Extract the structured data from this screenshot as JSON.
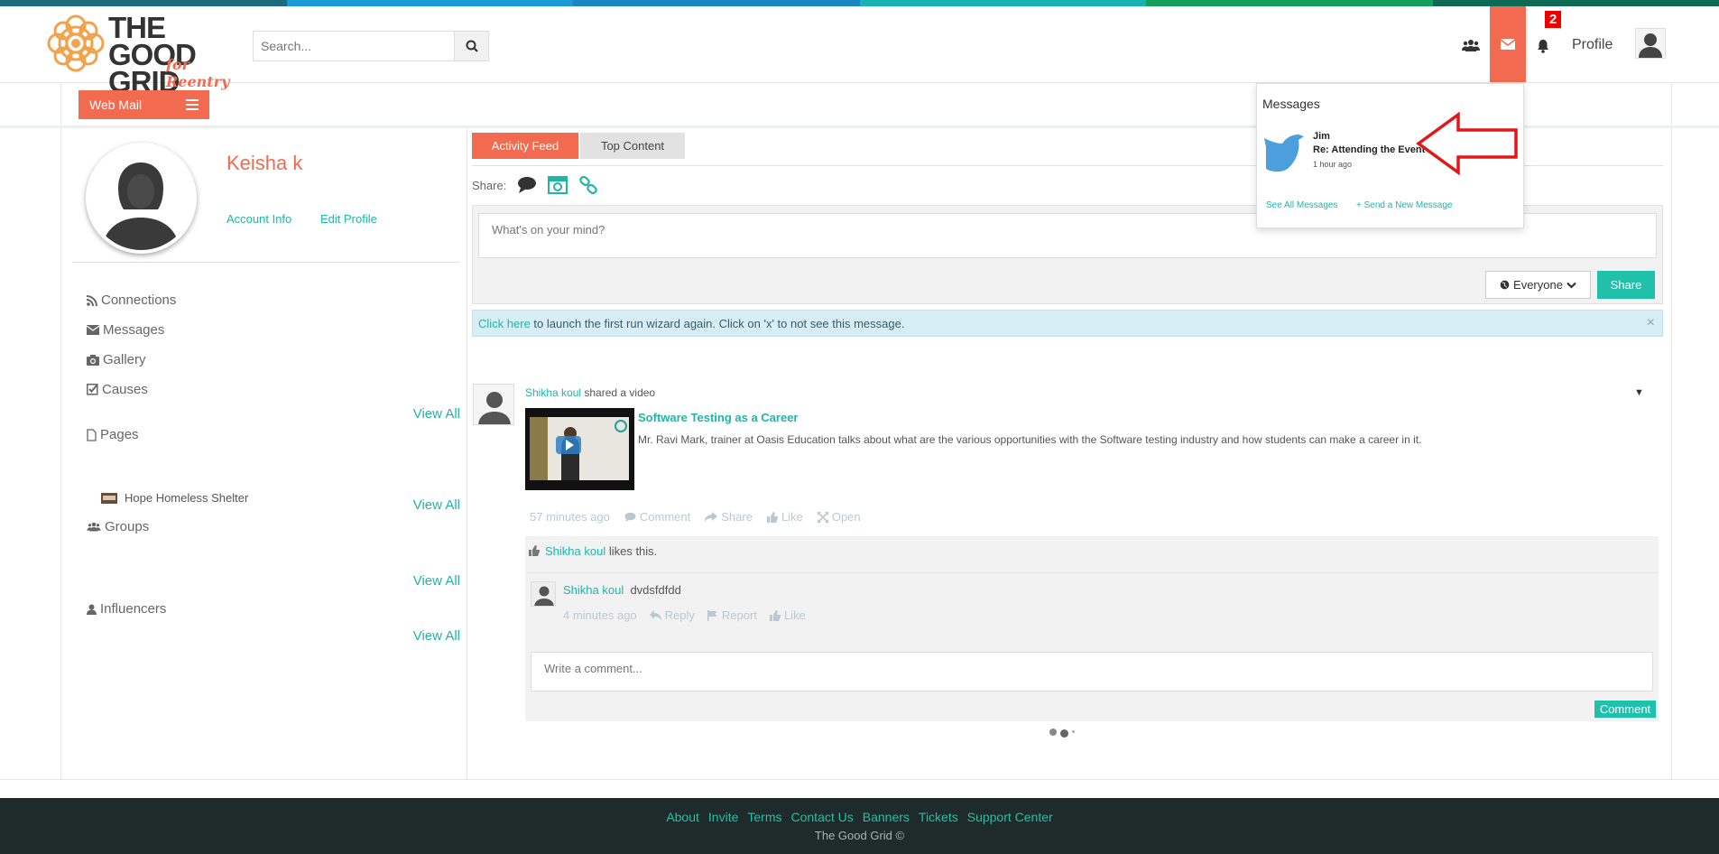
{
  "colors": {
    "accent": "#f26b50",
    "teal": "#20b5a8",
    "button_teal": "#20c0aa",
    "stripe": [
      "#1c6b7a",
      "#1b9bd6",
      "#1a86c6",
      "#19b3b5",
      "#14a05a",
      "#0d6b55"
    ]
  },
  "header": {
    "logo_line1": "THE GOOD",
    "logo_line2": "GRID",
    "logo_tagline": "for Reentry",
    "search_placeholder": "Search...",
    "icons": [
      "users-icon",
      "envelope-icon",
      "bell-icon"
    ],
    "notification_count": "2",
    "profile_label": "Profile"
  },
  "subbar": {
    "webmail_label": "Web Mail"
  },
  "profile": {
    "name": "Keisha k",
    "account_info": "Account Info",
    "edit_profile": "Edit Profile"
  },
  "sidebar": {
    "connections": "Connections",
    "messages": "Messages",
    "gallery": "Gallery",
    "causes": "Causes",
    "pages": "Pages",
    "page_item": "Hope Homeless Shelter",
    "groups": "Groups",
    "influencers": "Influencers",
    "view_all": "View All"
  },
  "main": {
    "tabs": [
      "Activity Feed",
      "Top Content"
    ],
    "share_label": "Share:",
    "composer_placeholder": "What's on your mind?",
    "visibility": "Everyone",
    "share_button": "Share",
    "alert_link": "Click here",
    "alert_text": " to launch the first run wizard again. Click on 'x' to not see this message.",
    "alert_close": "×"
  },
  "post": {
    "author": "Shikha koul",
    "action": " shared a video",
    "video_title": "Software Testing as a Career",
    "video_desc": "Mr. Ravi Mark, trainer at Oasis Education talks about what are the various opportunities with the Software testing industry and how students can make a career in it.",
    "time": "57 minutes ago",
    "comment": "Comment",
    "share": "Share",
    "like": "Like",
    "open": "Open",
    "likes_author": "Shikha koul",
    "likes_text": " likes this.",
    "comment_item": {
      "author": "Shikha koul",
      "text": "dvdsfdfdd",
      "time": "4 minutes ago",
      "reply": "Reply",
      "report": "Report",
      "like": "Like"
    },
    "comment_placeholder": "Write a comment...",
    "comment_button": "Comment"
  },
  "messages_dropdown": {
    "title": "Messages",
    "from": "Jim",
    "subject": "Re: Attending the Event",
    "time": "1 hour ago",
    "see_all": "See All Messages",
    "send_new": "Send a New Message"
  },
  "footer": {
    "links": [
      "About",
      "Invite",
      "Terms",
      "Contact Us",
      "Banners",
      "Tickets",
      "Support Center"
    ],
    "copyright": "The Good Grid ©"
  }
}
